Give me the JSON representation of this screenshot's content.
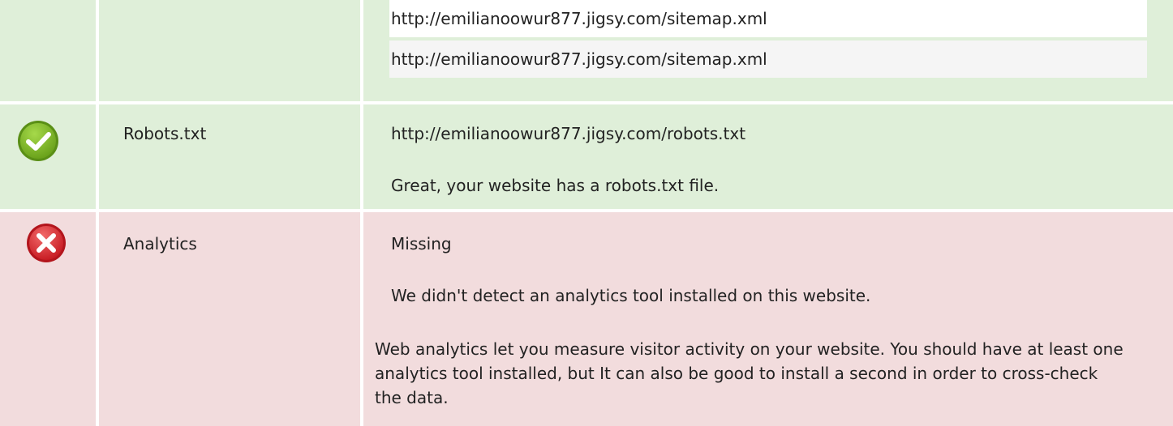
{
  "sitemap": {
    "urls": [
      "http://emilianoowur877.jigsy.com/sitemap.xml",
      "http://emilianoowur877.jigsy.com/sitemap.xml"
    ]
  },
  "robots": {
    "label": "Robots.txt",
    "url": "http://emilianoowur877.jigsy.com/robots.txt",
    "message": "Great, your website has a robots.txt file.",
    "status_icon": "check-icon",
    "status_color": "#7ab82a"
  },
  "analytics": {
    "label": "Analytics",
    "status": "Missing",
    "message": "We didn't detect an analytics tool installed on this website.",
    "description": "Web analytics let you measure visitor activity on your website. You should have at least one analytics tool installed, but It can also be good to install a second in order to cross-check the data.",
    "status_icon": "error-x-icon",
    "status_color": "#e0202a"
  },
  "colors": {
    "pass_bg": "#dfefd9",
    "fail_bg": "#f2dcdd"
  }
}
